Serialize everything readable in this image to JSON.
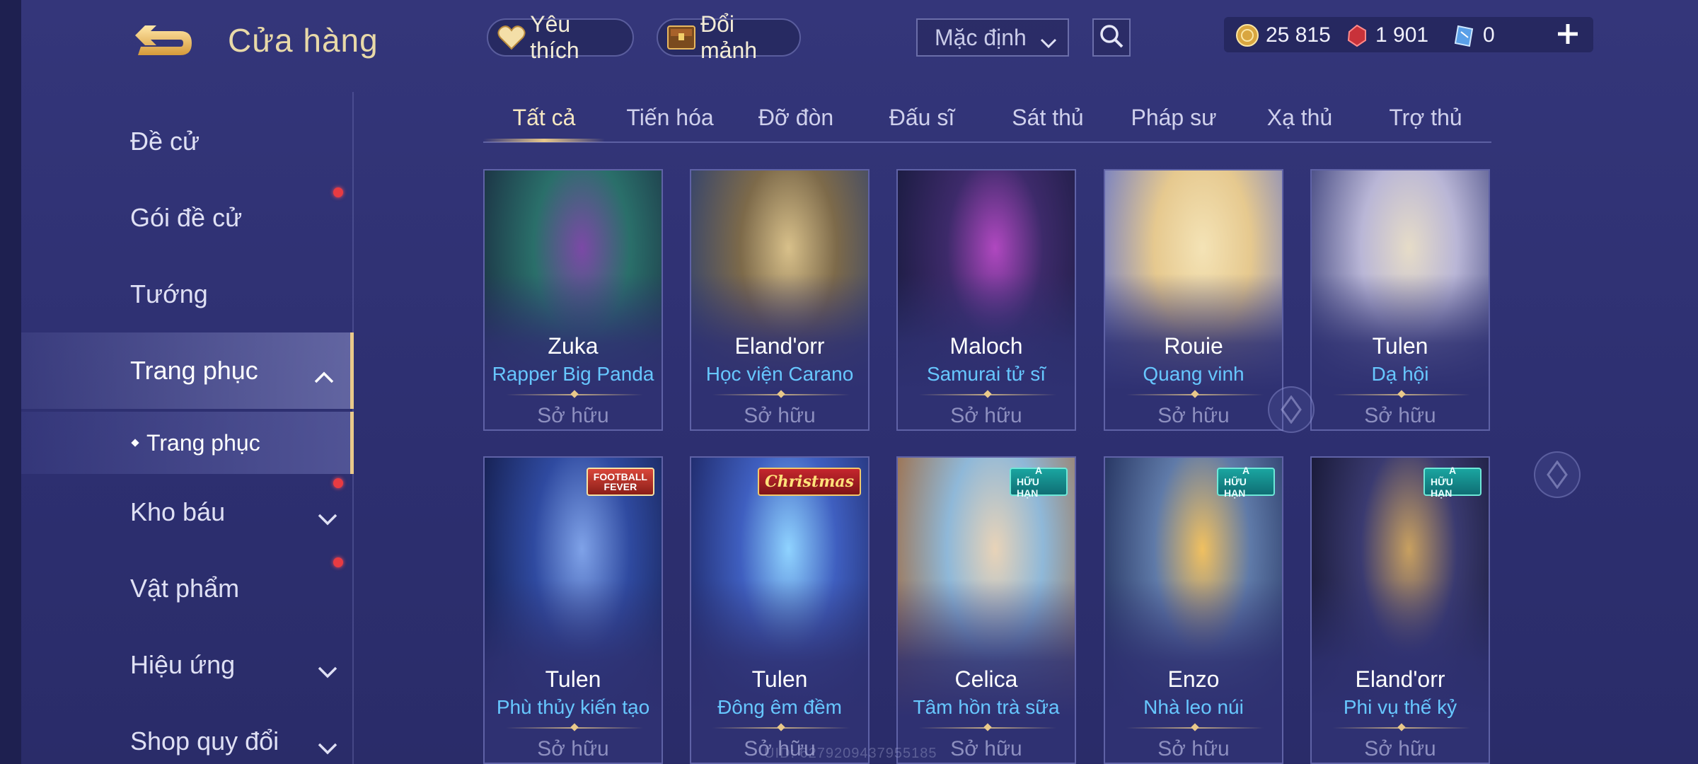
{
  "header": {
    "title": "Cửa hàng",
    "favorites_label": "Yêu thích",
    "shard_label": "Đổi mảnh",
    "sort_value": "Mặc định"
  },
  "currency": {
    "gold": "25 815",
    "ruby": "1 901",
    "token": "0"
  },
  "sidebar": {
    "items": [
      {
        "label": "Đề cử"
      },
      {
        "label": "Gói đề cử"
      },
      {
        "label": "Tướng"
      },
      {
        "label": "Trang phục"
      },
      {
        "label": "Trang phục"
      },
      {
        "label": "Kho báu"
      },
      {
        "label": "Vật phẩm"
      },
      {
        "label": "Hiệu ứng"
      },
      {
        "label": "Shop quy đổi"
      }
    ]
  },
  "tabs": [
    "Tất cả",
    "Tiến hóa",
    "Đỡ đòn",
    "Đấu sĩ",
    "Sát thủ",
    "Pháp sư",
    "Xạ thủ",
    "Trợ thủ"
  ],
  "cards": [
    {
      "hero": "Zuka",
      "skin": "Rapper Big Panda",
      "status": "Sở hữu",
      "colors": [
        "#2a6f6a",
        "#1a2b40",
        "#7b49a6"
      ]
    },
    {
      "hero": "Eland'orr",
      "skin": "Học viện Carano",
      "status": "Sở hữu",
      "colors": [
        "#7d6a4a",
        "#2c3f70",
        "#d8c08a"
      ]
    },
    {
      "hero": "Maloch",
      "skin": "Samurai tử sĩ",
      "status": "Sở hữu",
      "colors": [
        "#3d2a6a",
        "#161a3c",
        "#b048c0"
      ]
    },
    {
      "hero": "Rouie",
      "skin": "Quang vinh",
      "status": "Sở hữu",
      "colors": [
        "#e6c98f",
        "#6a78c8",
        "#f4e3b6"
      ]
    },
    {
      "hero": "Tulen",
      "skin": "Dạ hội",
      "status": "Sở hữu",
      "colors": [
        "#b9b6d6",
        "#3a3f7a",
        "#e6dcc8"
      ]
    },
    {
      "hero": "Tulen",
      "skin": "Phù thủy kiến tạo",
      "status": "Sở hữu",
      "colors": [
        "#2f4aa0",
        "#131b48",
        "#7fa2e8"
      ],
      "badge": "football",
      "badge_lines": [
        "FOOTBALL",
        "FEVER"
      ]
    },
    {
      "hero": "Tulen",
      "skin": "Đông êm đềm",
      "status": "Sở hữu",
      "colors": [
        "#3f5fc0",
        "#1c2461",
        "#8fd3ff"
      ],
      "badge": "christmas",
      "badge_text": "Christmas"
    },
    {
      "hero": "Celica",
      "skin": "Tâm hồn trà sữa",
      "status": "Sở hữu",
      "colors": [
        "#8fb8d8",
        "#a06a40",
        "#e8d3b8"
      ],
      "badge": "limited",
      "badge_lines": [
        "A",
        "HỮU HẠN"
      ]
    },
    {
      "hero": "Enzo",
      "skin": "Nhà leo núi",
      "status": "Sở hữu",
      "colors": [
        "#5f7aa8",
        "#1e2b58",
        "#f0c060"
      ],
      "badge": "limited",
      "badge_lines": [
        "A",
        "HỮU HẠN"
      ]
    },
    {
      "hero": "Eland'orr",
      "skin": "Phi vụ thế kỷ",
      "status": "Sở hữu",
      "colors": [
        "#3a3a70",
        "#141530",
        "#c8a060"
      ],
      "badge": "limited",
      "badge_lines": [
        "A",
        "HỮU HẠN"
      ]
    }
  ],
  "footer": {
    "uid": "UID: 6279209437955185"
  }
}
